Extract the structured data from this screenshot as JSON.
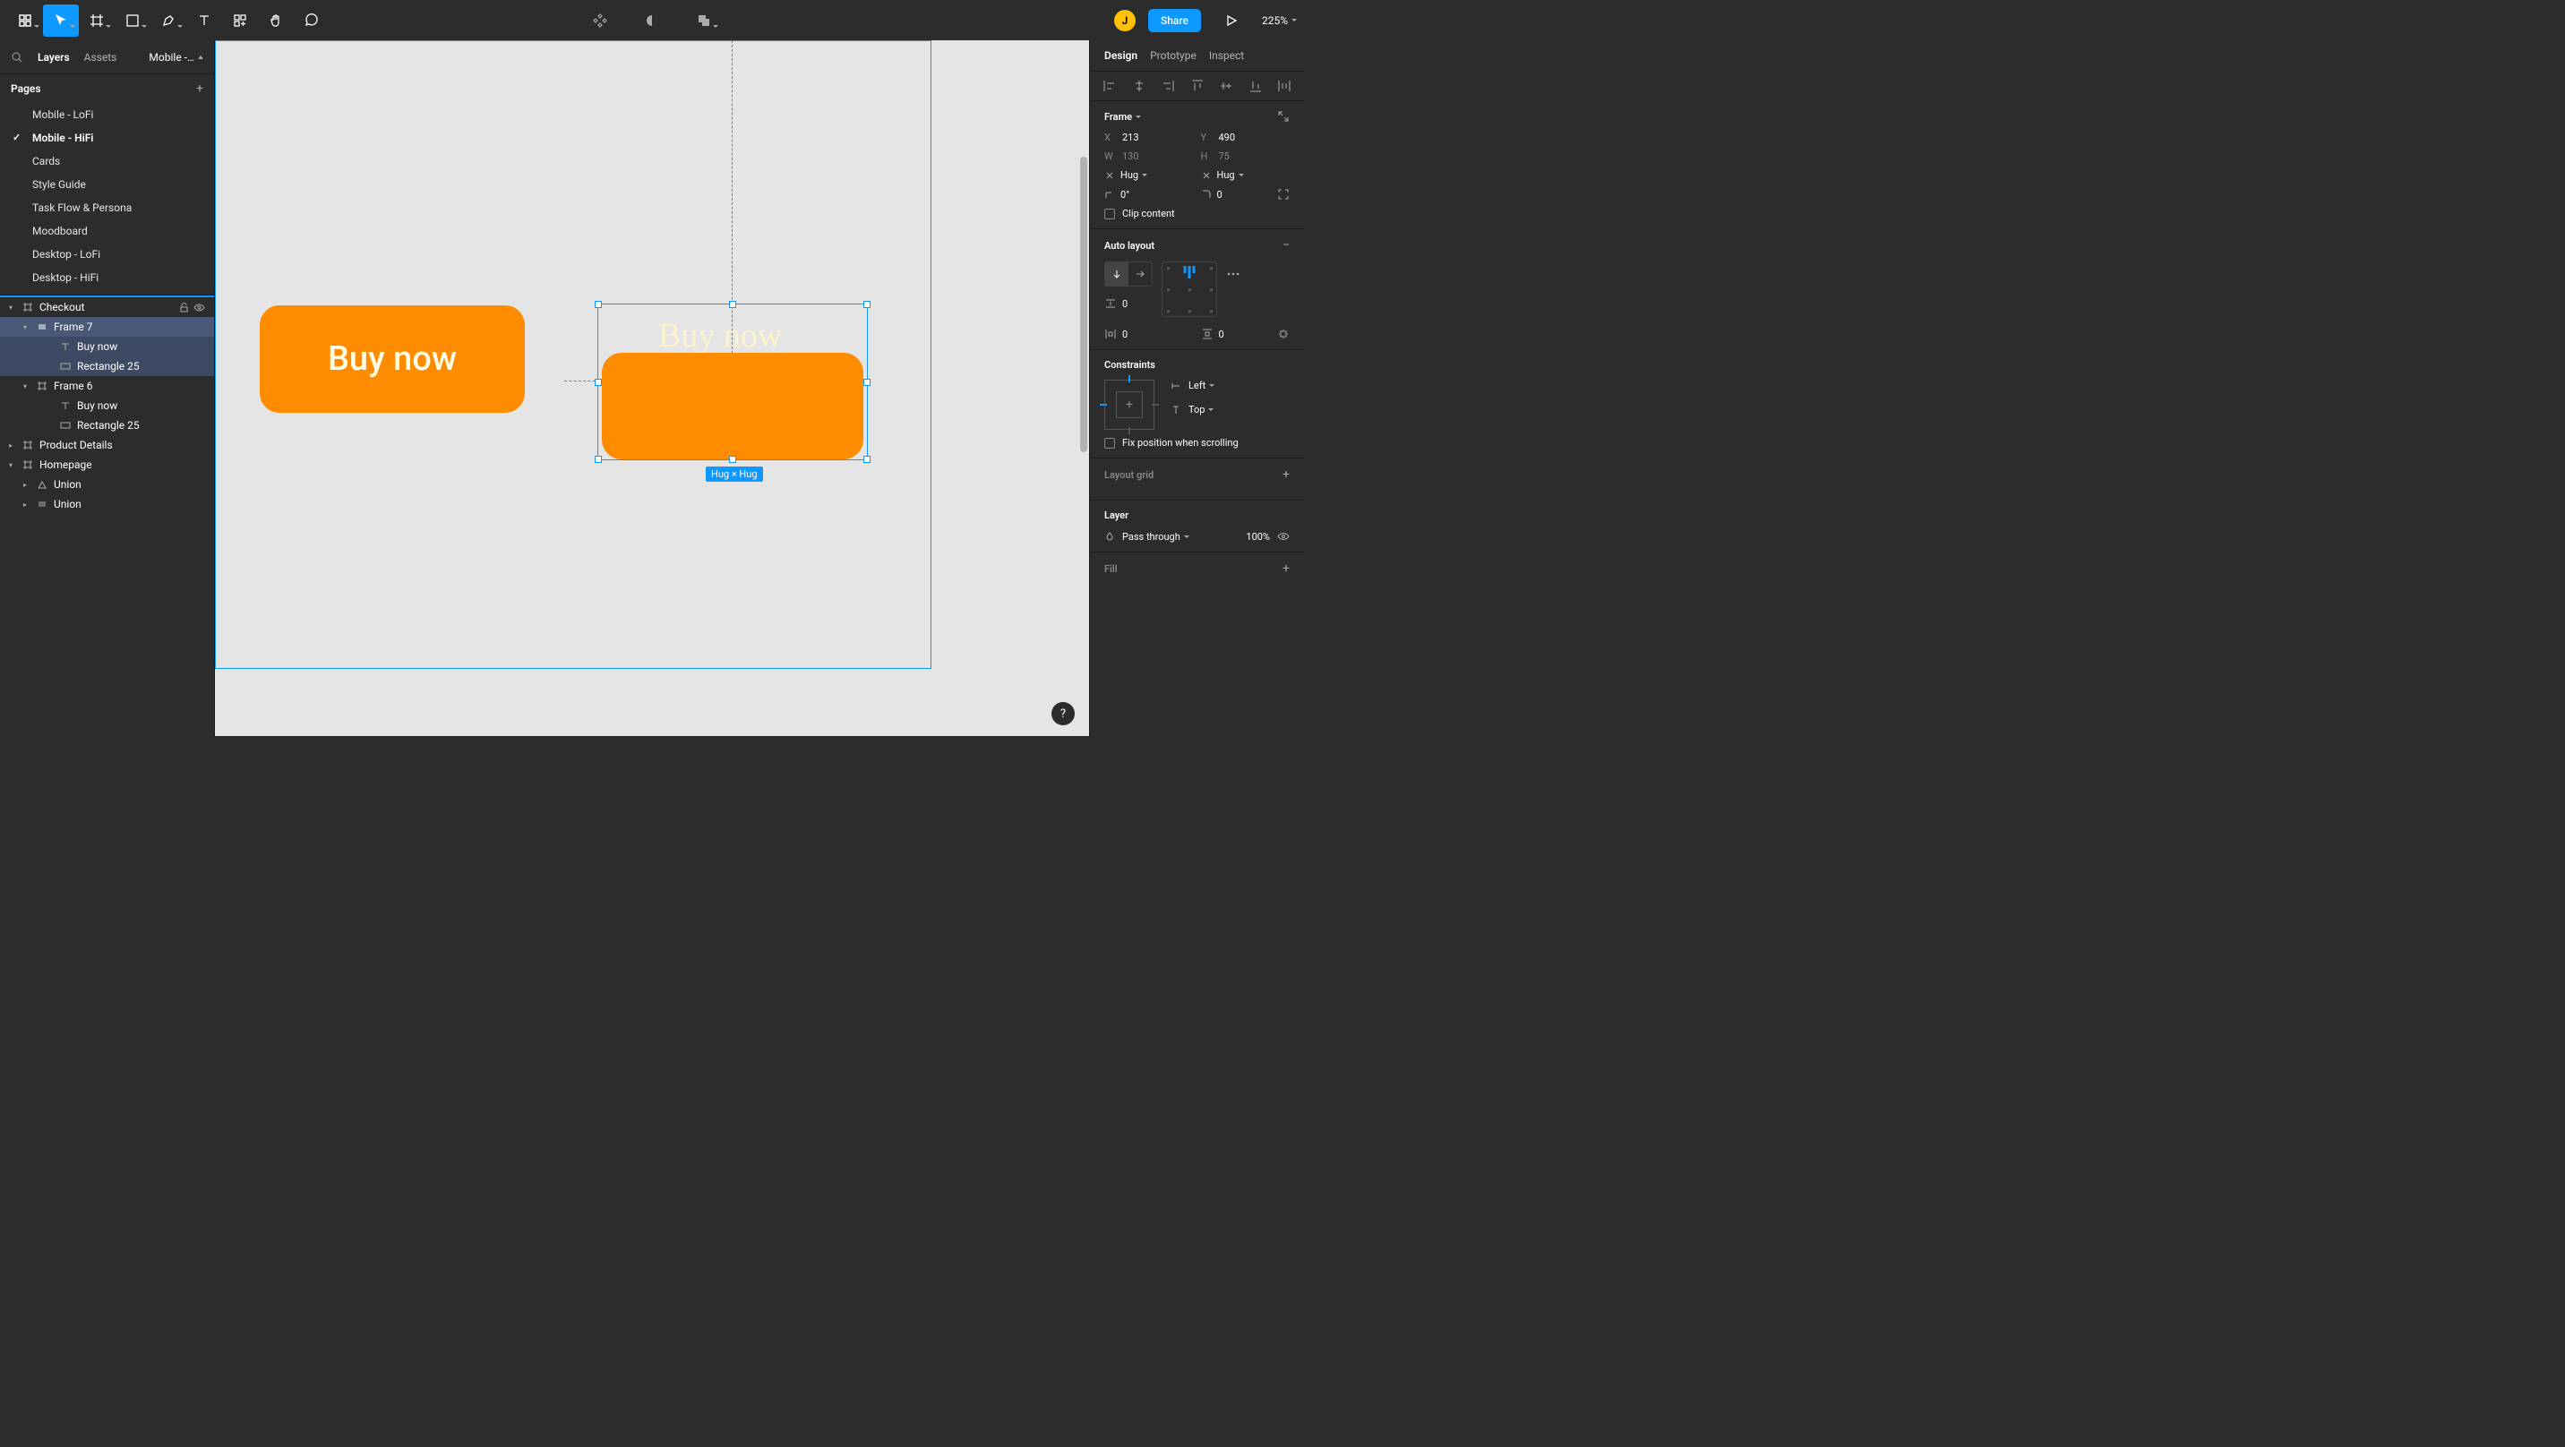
{
  "toolbar": {
    "share_label": "Share",
    "zoom": "225%",
    "avatar_initial": "J"
  },
  "left_panel": {
    "tab_layers": "Layers",
    "tab_assets": "Assets",
    "page_select": "Mobile -…",
    "pages_header": "Pages",
    "pages": [
      "Mobile - LoFi",
      "Mobile - HiFi",
      "Cards",
      "Style Guide",
      "Task Flow & Persona",
      "Moodboard",
      "Desktop - LoFi",
      "Desktop - HiFi"
    ],
    "active_page_index": 1,
    "layers": {
      "checkout": "Checkout",
      "frame7": "Frame 7",
      "frame7_text": "Buy now",
      "frame7_rect": "Rectangle 25",
      "frame6": "Frame 6",
      "frame6_text": "Buy now",
      "frame6_rect": "Rectangle 25",
      "product_details": "Product Details",
      "homepage": "Homepage",
      "union1": "Union",
      "union2": "Union"
    }
  },
  "canvas": {
    "btn1_text": "Buy now",
    "btn2_text": "Buy now",
    "size_badge": "Hug × Hug"
  },
  "right_panel": {
    "tab_design": "Design",
    "tab_prototype": "Prototype",
    "tab_inspect": "Inspect",
    "frame_label": "Frame",
    "x": "213",
    "y": "490",
    "w": "130",
    "h": "75",
    "hug": "Hug",
    "rotation": "0°",
    "radius": "0",
    "clip_content": "Clip content",
    "auto_layout_label": "Auto layout",
    "gap": "0",
    "pad_h": "0",
    "pad_v": "0",
    "constraints_label": "Constraints",
    "constraint_h": "Left",
    "constraint_v": "Top",
    "fix_position": "Fix position when scrolling",
    "layout_grid_label": "Layout grid",
    "layer_label": "Layer",
    "blend_mode": "Pass through",
    "opacity": "100%",
    "fill_label": "Fill"
  }
}
